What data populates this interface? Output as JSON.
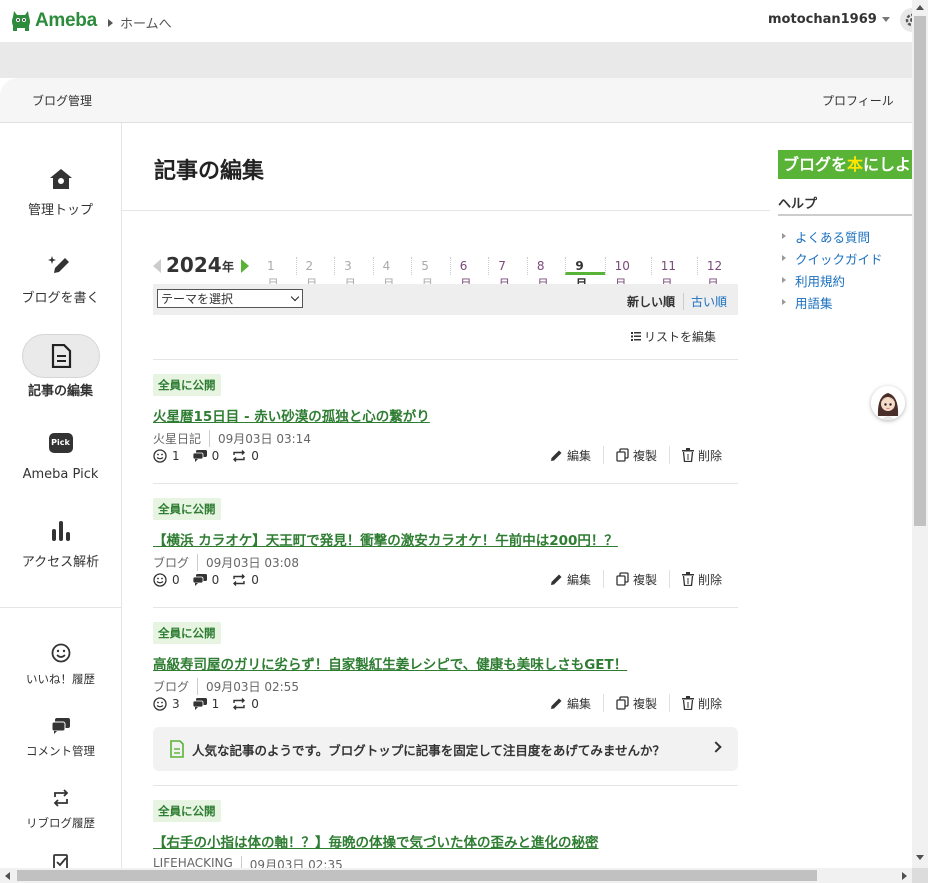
{
  "topbar": {
    "logo_text": "Ameba",
    "home_link": "ホームへ",
    "username": "motochan1969"
  },
  "subheader": {
    "left": "ブログ管理",
    "right": "プロフィール"
  },
  "sidebar": {
    "items": [
      {
        "label": "管理トップ",
        "icon": "home-icon"
      },
      {
        "label": "ブログを書く",
        "icon": "pen-icon"
      },
      {
        "label": "記事の編集",
        "icon": "document-icon",
        "active": true
      },
      {
        "label": "Ameba Pick",
        "icon": "pick-icon",
        "icon_text": "Pick"
      },
      {
        "label": "アクセス解析",
        "icon": "bar-chart-icon"
      }
    ],
    "sub_items": [
      {
        "label": "いいね！履歴",
        "icon": "smile-icon"
      },
      {
        "label": "コメント管理",
        "icon": "comment-icon"
      },
      {
        "label": "リブログ履歴",
        "icon": "reblog-icon"
      }
    ]
  },
  "main": {
    "title": "記事の編集",
    "year": "2024",
    "year_suffix": "年",
    "months": [
      "1月",
      "2月",
      "3月",
      "4月",
      "5月",
      "6月",
      "7月",
      "8月",
      "9月",
      "10月",
      "11月",
      "12月"
    ],
    "months_with_posts": [
      6,
      7,
      8,
      9,
      10,
      11,
      12
    ],
    "current_month": 9,
    "theme_select": "テーマを選択",
    "sort_new": "新しい順",
    "sort_old": "古い順",
    "edit_list": "リストを編集",
    "action_edit": "編集",
    "action_copy": "複製",
    "action_delete": "削除",
    "articles": [
      {
        "status": "全員に公開",
        "title": "火星暦15日目 - 赤い砂漠の孤独と心の繋がり",
        "theme": "火星日記",
        "date": "09月03日 03:14",
        "likes": "1",
        "comments": "0",
        "reblogs": "0"
      },
      {
        "status": "全員に公開",
        "title": "【横浜 カラオケ】天王町で発見！衝撃の激安カラオケ！午前中は200円！？",
        "theme": "ブログ",
        "date": "09月03日 03:08",
        "likes": "0",
        "comments": "0",
        "reblogs": "0"
      },
      {
        "status": "全員に公開",
        "title": "高級寿司屋のガリに劣らず！自家製紅生姜レシピで、健康も美味しさもGET！",
        "theme": "ブログ",
        "date": "09月03日 02:55",
        "likes": "3",
        "comments": "1",
        "reblogs": "0"
      },
      {
        "status": "全員に公開",
        "title": "【右手の小指は体の軸！？】毎晩の体操で気づいた体の歪みと進化の秘密",
        "theme": "LIFEHACKING",
        "date": "09月03日 02:35"
      }
    ],
    "promo_text": "人気な記事のようです。ブログトップに記事を固定して注目度をあげてみませんか？"
  },
  "rightcol": {
    "banner_a": "ブログを",
    "banner_hl": "本",
    "banner_b": "にしよう",
    "help_title": "ヘルプ",
    "help_links": [
      "よくある質問",
      "クイックガイド",
      "利用規約",
      "用語集"
    ]
  },
  "colors": {
    "brand_green": "#2d8c3c",
    "accent_green": "#59b336",
    "link_blue": "#1a6fbf",
    "badge_bg": "#e6f4e1"
  }
}
